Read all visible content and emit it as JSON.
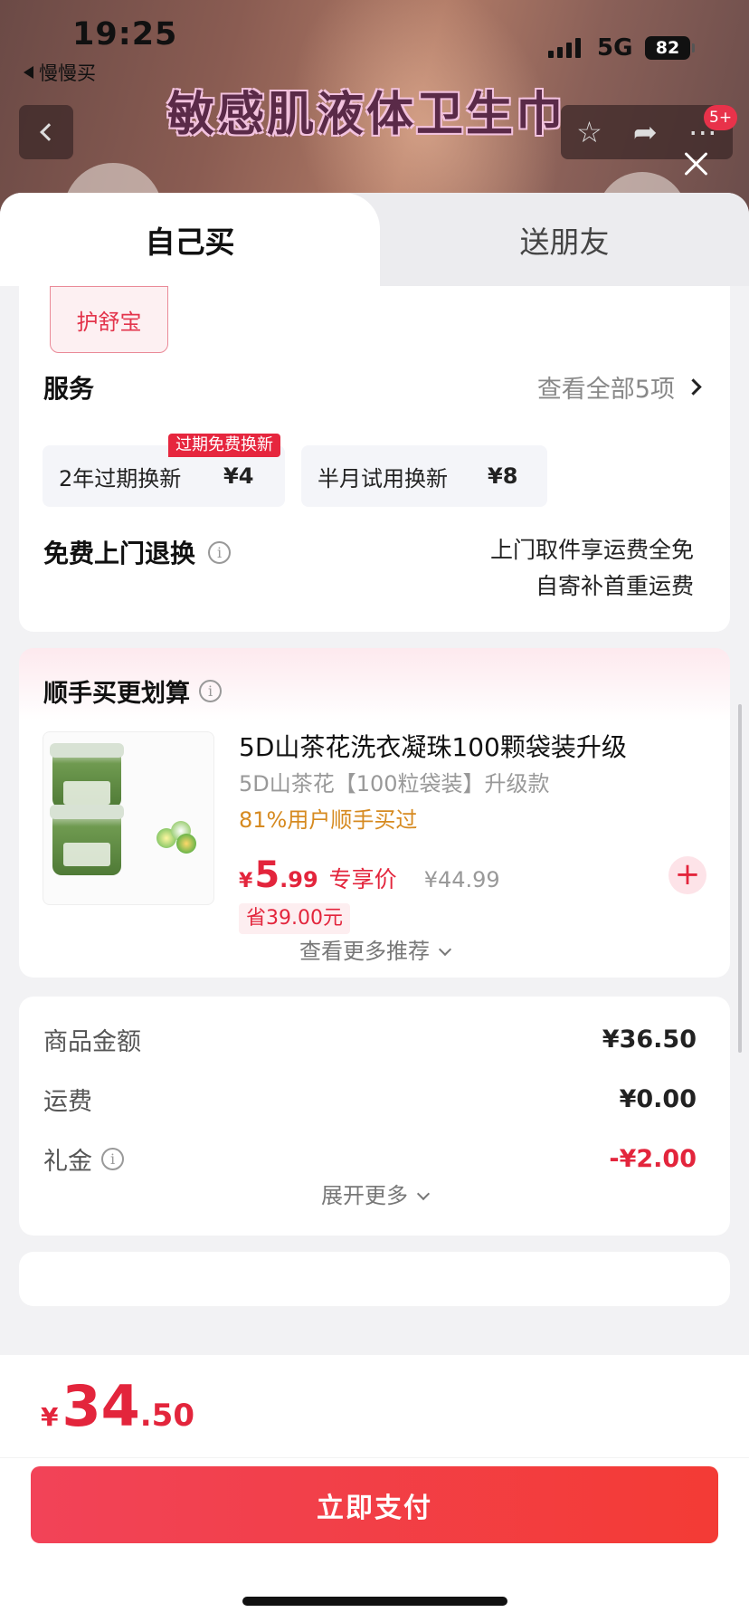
{
  "status_bar": {
    "time": "19:25",
    "back_app": "慢慢买",
    "network": "5G",
    "battery": "82"
  },
  "background_page": {
    "banner_text": "敏感肌液体卫生巾",
    "cart_badge": "5+"
  },
  "tabs": [
    {
      "label": "自己买",
      "active": true
    },
    {
      "label": "送朋友",
      "active": false
    }
  ],
  "service_section": {
    "selected_chip": "护舒宝",
    "title": "服务",
    "view_all": "查看全部5项",
    "options": [
      {
        "name": "2年过期换新",
        "price": "¥4",
        "badge": "过期免费换新"
      },
      {
        "name": "半月试用换新",
        "price": "¥8"
      }
    ],
    "free_return_title": "免费上门退换",
    "free_return_desc_line1": "上门取件享运费全免",
    "free_return_desc_line2": "自寄补首重运费"
  },
  "addon_section": {
    "title": "顺手买更划算",
    "product": {
      "name": "5D山茶花洗衣凝珠100颗袋装升级",
      "subtitle": "5D山茶花【100粒袋装】升级款",
      "bought_hint": "81%用户顺手买过",
      "price_symbol": "¥",
      "price_int": "5",
      "price_dec": ".99",
      "price_label": "专享价",
      "original_price": "¥44.99",
      "save_text": "省39.00元"
    },
    "more": "查看更多推荐"
  },
  "fees": {
    "rows": [
      {
        "label": "商品金额",
        "value": "¥36.50",
        "info": false,
        "highlight": false
      },
      {
        "label": "运费",
        "value": "¥0.00",
        "info": false,
        "highlight": false
      },
      {
        "label": "礼金",
        "value": "-¥2.00",
        "info": true,
        "highlight": true
      }
    ],
    "expand": "展开更多"
  },
  "footer": {
    "total_symbol": "¥",
    "total_int": "34",
    "total_dec": ".50",
    "pay_button": "立即支付"
  },
  "colors": {
    "accent_red": "#e3253c",
    "pay_gradient_start": "#f24358",
    "pay_gradient_end": "#f33b35",
    "bought_hint": "#d68a20"
  }
}
